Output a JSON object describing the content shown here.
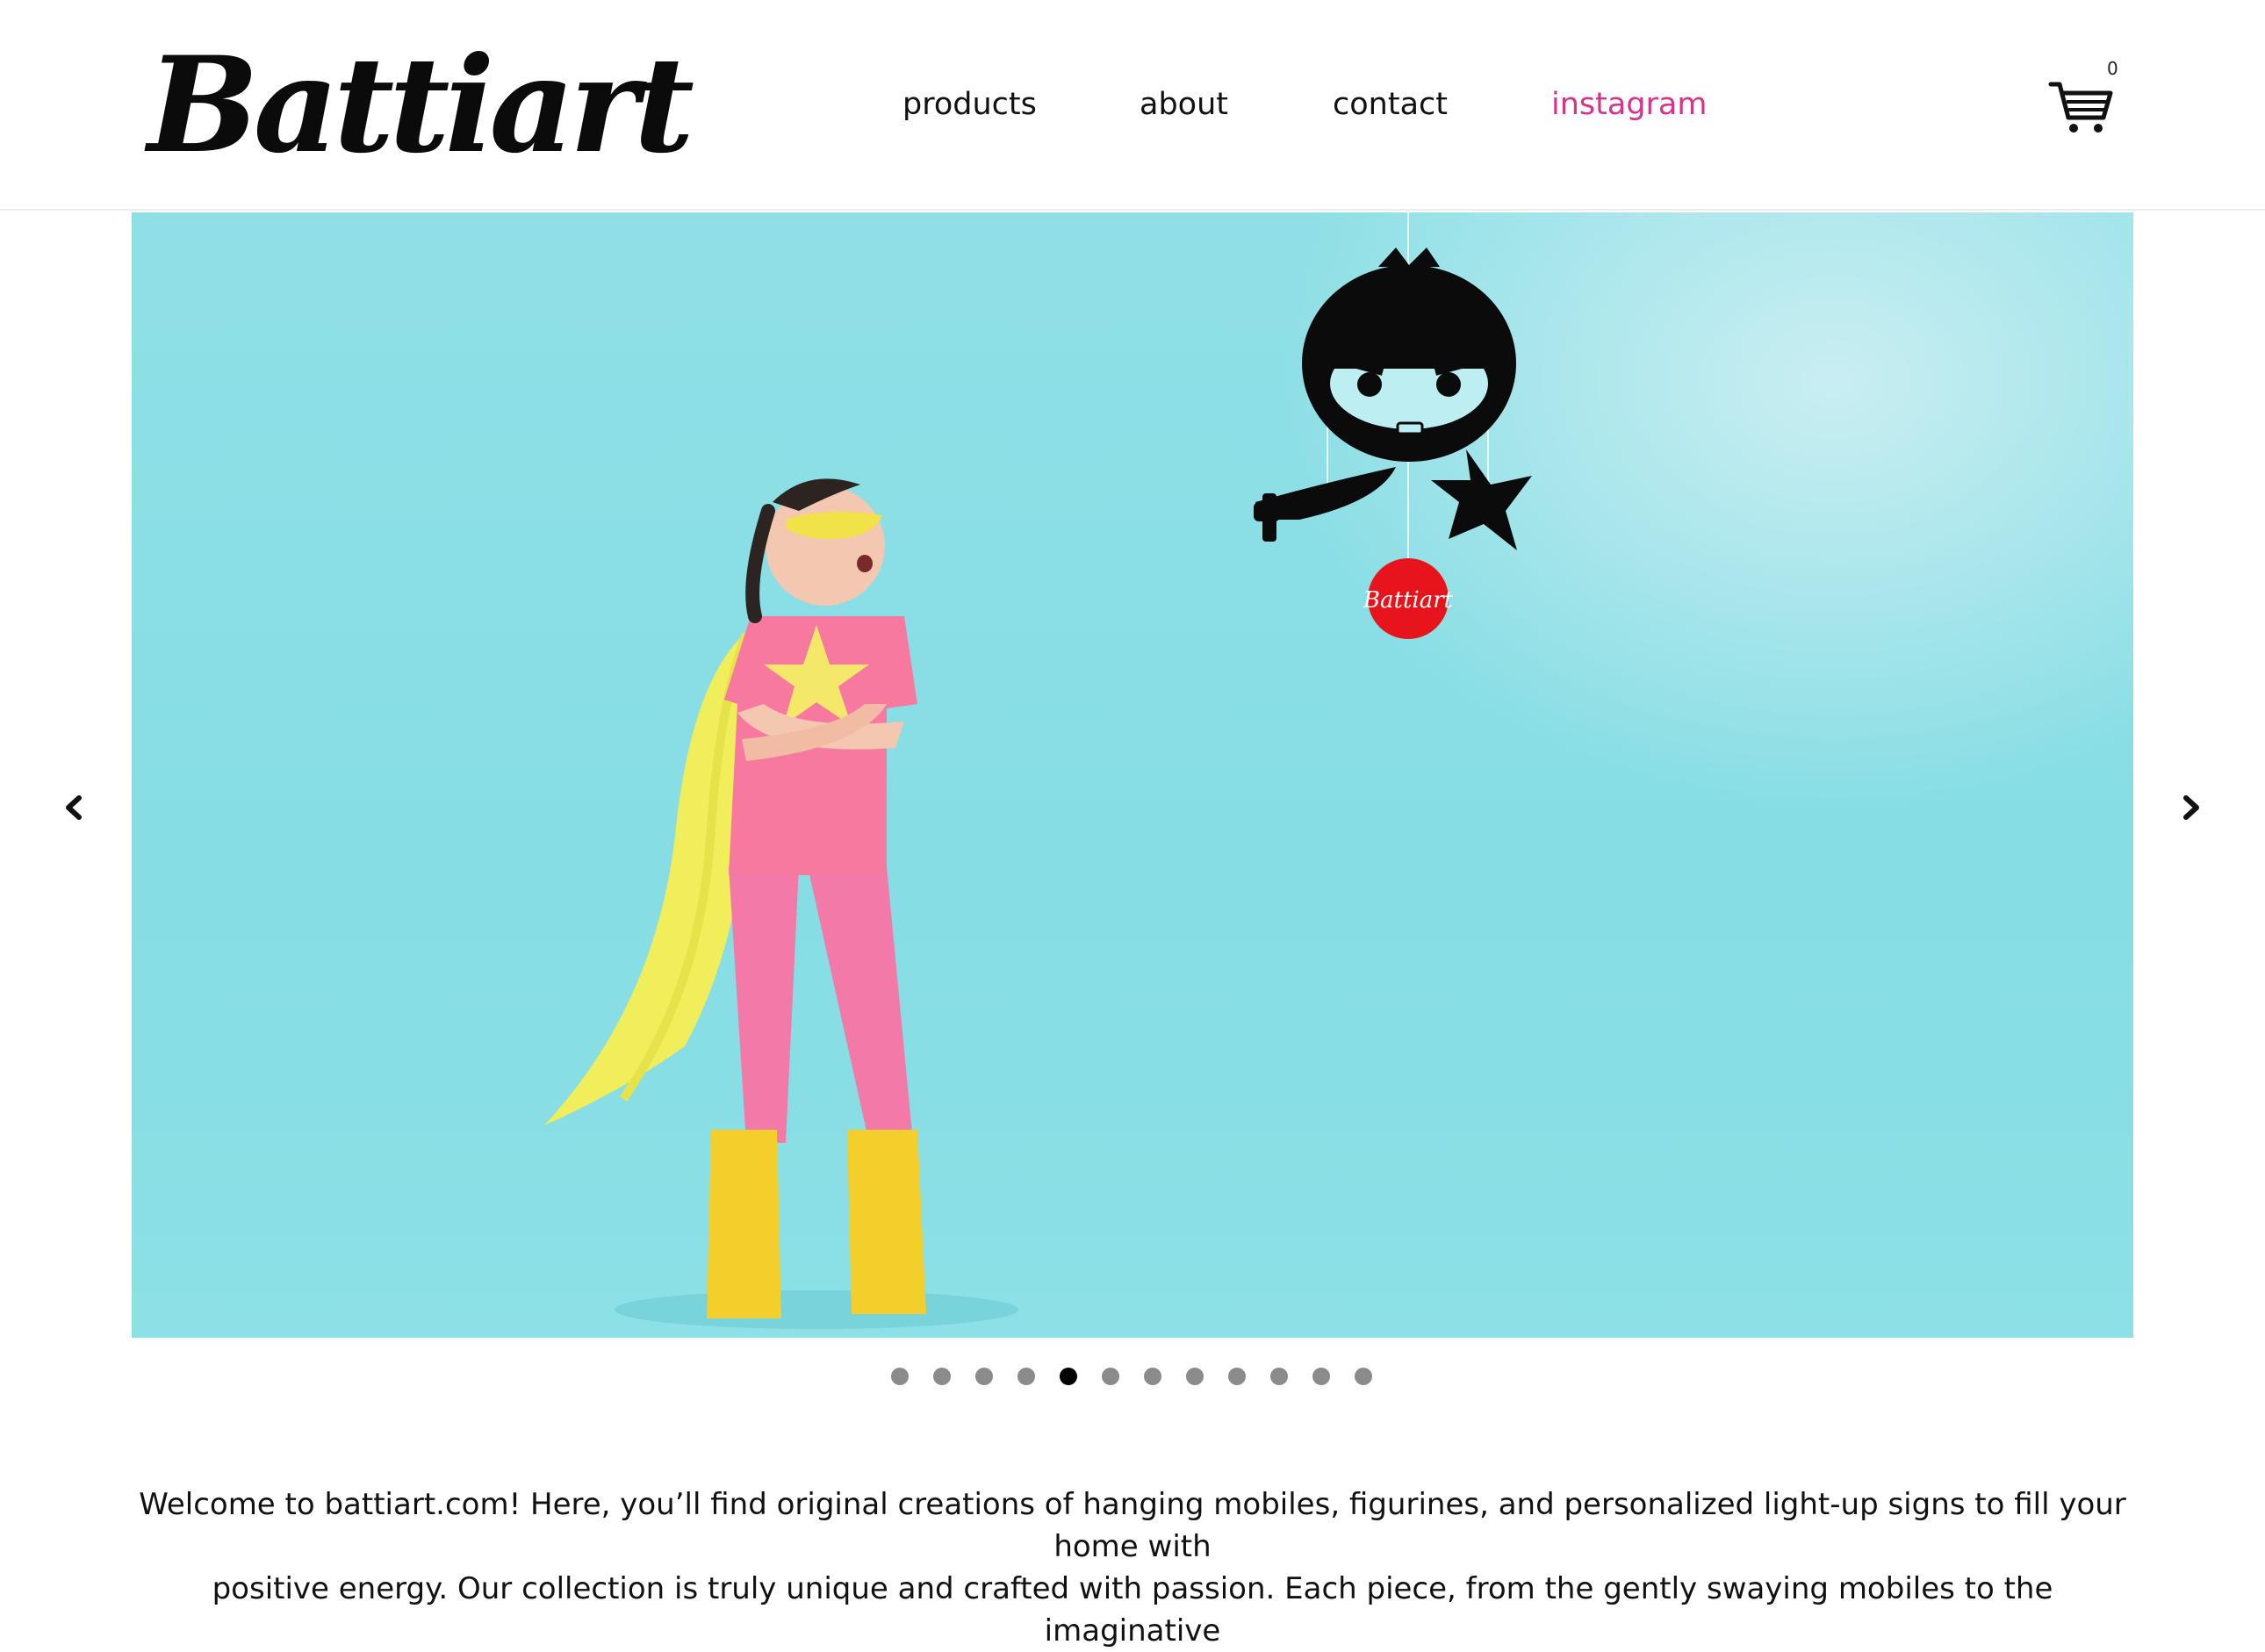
{
  "brand": {
    "logo_text": "Battiart",
    "badge_text": "Battiart"
  },
  "nav": [
    {
      "label": "products"
    },
    {
      "label": "about"
    },
    {
      "label": "contact"
    },
    {
      "label": "instagram"
    }
  ],
  "cart": {
    "count": "0",
    "icon": "cart-icon"
  },
  "carousel": {
    "slide_count": 12,
    "active_index": 4,
    "prev_icon": "chevron-left-icon",
    "next_icon": "chevron-right-icon"
  },
  "intro": {
    "line1": "Welcome to battiart.com! Here, you’ll find original creations of hanging mobiles, figurines, and personalized light-up signs to fill your home with",
    "line2": "positive energy. Our collection is truly unique and crafted with passion. Each piece, from the gently swaying mobiles to the imaginative"
  },
  "colors": {
    "accent": "#d6338a",
    "hero_bg": "#8fe0e6",
    "badge_red": "#e8141c"
  }
}
